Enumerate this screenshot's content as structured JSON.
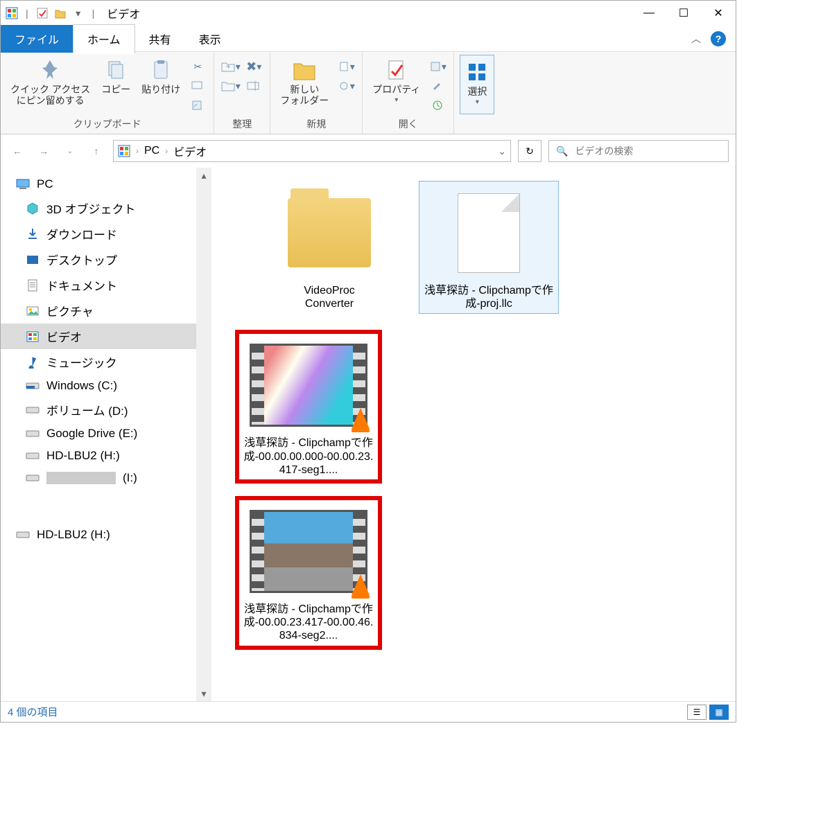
{
  "title": "ビデオ",
  "tabs": {
    "file": "ファイル",
    "home": "ホーム",
    "share": "共有",
    "view": "表示"
  },
  "ribbon": {
    "clipboard": {
      "label": "クリップボード",
      "pin": "クイック アクセス\nにピン留めする",
      "copy": "コピー",
      "paste": "貼り付け"
    },
    "organize": {
      "label": "整理"
    },
    "new_group": {
      "label": "新規",
      "newfolder": "新しい\nフォルダー"
    },
    "open_group": {
      "label": "開く",
      "properties": "プロパティ"
    },
    "select_group": {
      "label": "",
      "select": "選択"
    }
  },
  "breadcrumb": {
    "pc": "PC",
    "folder": "ビデオ"
  },
  "search_placeholder": "ビデオの検索",
  "nav": {
    "pc": "PC",
    "items": [
      "3D オブジェクト",
      "ダウンロード",
      "デスクトップ",
      "ドキュメント",
      "ピクチャ",
      "ビデオ",
      "ミュージック",
      "Windows (C:)",
      "ボリューム (D:)",
      "Google Drive (E:)",
      "HD-LBU2 (H:)",
      "(I:)"
    ],
    "extra": "HD-LBU2 (H:)"
  },
  "files": {
    "f1": "VideoProc\nConverter",
    "f2": "浅草探訪 - Clipchampで作成-proj.llc",
    "f3": "浅草探訪 - Clipchampで作成-00.00.00.000-00.00.23.417-seg1....",
    "f4": "浅草探訪 - Clipchampで作成-00.00.23.417-00.00.46.834-seg2...."
  },
  "status": "4 個の項目"
}
